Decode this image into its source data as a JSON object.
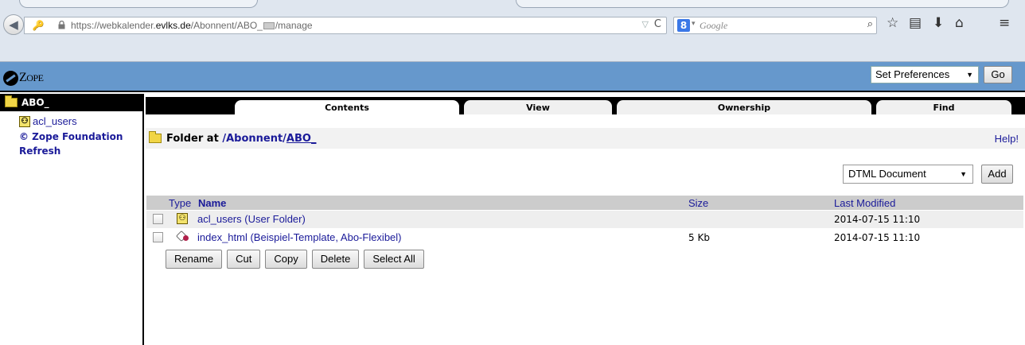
{
  "browser": {
    "url_prefix": "https://webkalender.",
    "url_domain": "evlks.de",
    "url_path": "/Abonnent/ABO_",
    "url_suffix": "/manage",
    "search_placeholder": "Google",
    "search_engine_label": "8"
  },
  "header": {
    "logo_text": "Z",
    "logo_text_small": "OPE",
    "prefs_select_value": "Set Preferences",
    "go_label": "Go"
  },
  "tree": {
    "root_label": "ABO_",
    "items": [
      {
        "label": "acl_users"
      }
    ],
    "links": [
      "© Zope Foundation",
      "Refresh"
    ]
  },
  "tabs": [
    {
      "label": "Contents"
    },
    {
      "label": "View"
    },
    {
      "label": "Ownership"
    },
    {
      "label": "Find"
    }
  ],
  "folder": {
    "prefix": "Folder at",
    "path_static": "/Abonnent/",
    "path_link": "ABO_",
    "help_label": "Help!"
  },
  "add": {
    "select_value": "DTML Document",
    "button_label": "Add"
  },
  "list": {
    "headers": {
      "type": "Type",
      "name": "Name",
      "size": "Size",
      "modified": "Last Modified"
    },
    "rows": [
      {
        "name": "acl_users (User Folder)",
        "size": "",
        "modified": "2014-07-15 11:10"
      },
      {
        "name": "index_html (Beispiel-Template, Abo-Flexibel)",
        "size": "5 Kb",
        "modified": "2014-07-15 11:10"
      }
    ]
  },
  "actions": [
    "Rename",
    "Cut",
    "Copy",
    "Delete",
    "Select All"
  ],
  "colors": {
    "header_blue": "#6698cc",
    "link_blue": "#1a1a99",
    "folder_yellow": "#f1d546"
  }
}
